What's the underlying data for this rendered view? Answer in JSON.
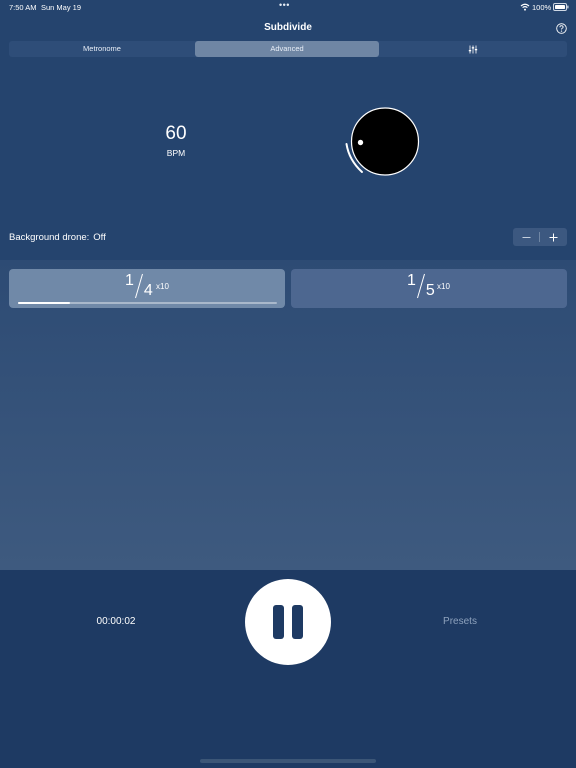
{
  "status_bar": {
    "time": "7:50 AM",
    "date": "Sun May 19",
    "dots": "•••",
    "battery": "100%"
  },
  "header": {
    "title": "Subdivide"
  },
  "segments": {
    "metronome": "Metronome",
    "advanced": "Advanced",
    "selected": "Advanced",
    "mixer_icon": "sliders-icon"
  },
  "tempo": {
    "bpm": "60",
    "unit": "BPM"
  },
  "drone": {
    "label": "Background drone:",
    "value": "Off",
    "minus": "−",
    "plus": "+"
  },
  "subdivisions": [
    {
      "numerator": "1",
      "denominator": "4",
      "multiplier": "x10",
      "active": true,
      "progress": 0.2
    },
    {
      "numerator": "1",
      "denominator": "5",
      "multiplier": "x10",
      "active": false
    }
  ],
  "transport": {
    "elapsed": "00:00:02",
    "presets": "Presets",
    "state": "playing"
  },
  "colors": {
    "background": "#25446e",
    "active_card": "#7089a8",
    "inactive_card": "#4d6790",
    "accent": "#ffffff"
  }
}
